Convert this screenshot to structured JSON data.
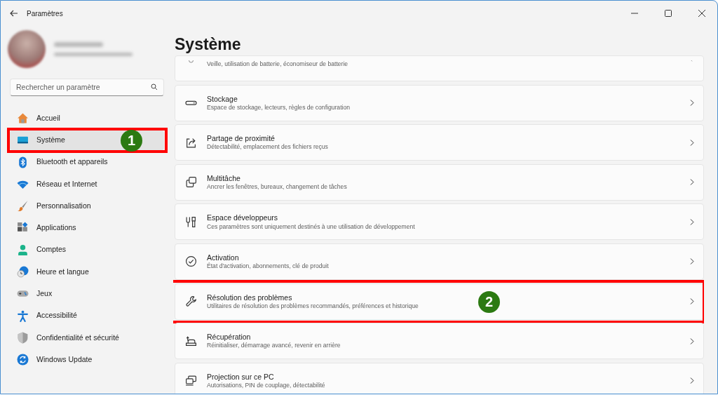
{
  "window": {
    "title": "Paramètres"
  },
  "search": {
    "placeholder": "Rechercher un paramètre"
  },
  "sidebar": {
    "items": [
      {
        "label": "Accueil",
        "selected": false
      },
      {
        "label": "Système",
        "selected": true,
        "annotation": "1"
      },
      {
        "label": "Bluetooth et appareils",
        "selected": false
      },
      {
        "label": "Réseau et Internet",
        "selected": false
      },
      {
        "label": "Personnalisation",
        "selected": false
      },
      {
        "label": "Applications",
        "selected": false
      },
      {
        "label": "Comptes",
        "selected": false
      },
      {
        "label": "Heure et langue",
        "selected": false
      },
      {
        "label": "Jeux",
        "selected": false
      },
      {
        "label": "Accessibilité",
        "selected": false
      },
      {
        "label": "Confidentialité et sécurité",
        "selected": false
      },
      {
        "label": "Windows Update",
        "selected": false
      }
    ]
  },
  "page": {
    "title": "Système",
    "cards": [
      {
        "subtitle": "Veille, utilisation de batterie, économiseur de batterie"
      },
      {
        "title": "Stockage",
        "subtitle": "Espace de stockage, lecteurs, règles de configuration"
      },
      {
        "title": "Partage de proximité",
        "subtitle": "Détectabilité, emplacement des fichiers reçus"
      },
      {
        "title": "Multitâche",
        "subtitle": "Ancrer les fenêtres, bureaux, changement de tâches"
      },
      {
        "title": "Espace développeurs",
        "subtitle": "Ces paramètres sont uniquement destinés à une utilisation de développement"
      },
      {
        "title": "Activation",
        "subtitle": "État d'activation, abonnements, clé de produit"
      },
      {
        "title": "Résolution des problèmes",
        "subtitle": "Utilitaires de résolution des problèmes recommandés, préférences et historique",
        "annotation": "2"
      },
      {
        "title": "Récupération",
        "subtitle": "Réinitialiser, démarrage avancé, revenir en arrière"
      },
      {
        "title": "Projection sur ce PC",
        "subtitle": "Autorisations, PIN de couplage, détectabilité"
      }
    ]
  }
}
